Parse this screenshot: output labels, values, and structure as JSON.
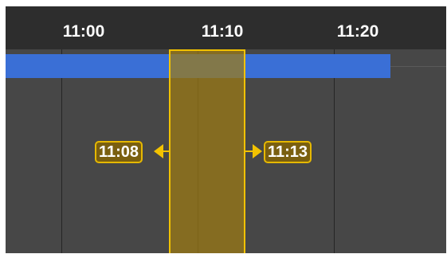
{
  "timeline": {
    "ticks": [
      "11:00",
      "11:10",
      "11:20"
    ]
  },
  "selection": {
    "start_label": "11:08",
    "end_label": "11:13"
  },
  "colors": {
    "header_bg": "#2d2d2d",
    "track_bg": "#474747",
    "event_bar": "#3a6fd6",
    "selection_border": "#f2c200",
    "selection_fill": "#9e7c14"
  },
  "icons": {
    "start_handle": "arrow-left-icon",
    "end_handle": "arrow-right-icon"
  }
}
